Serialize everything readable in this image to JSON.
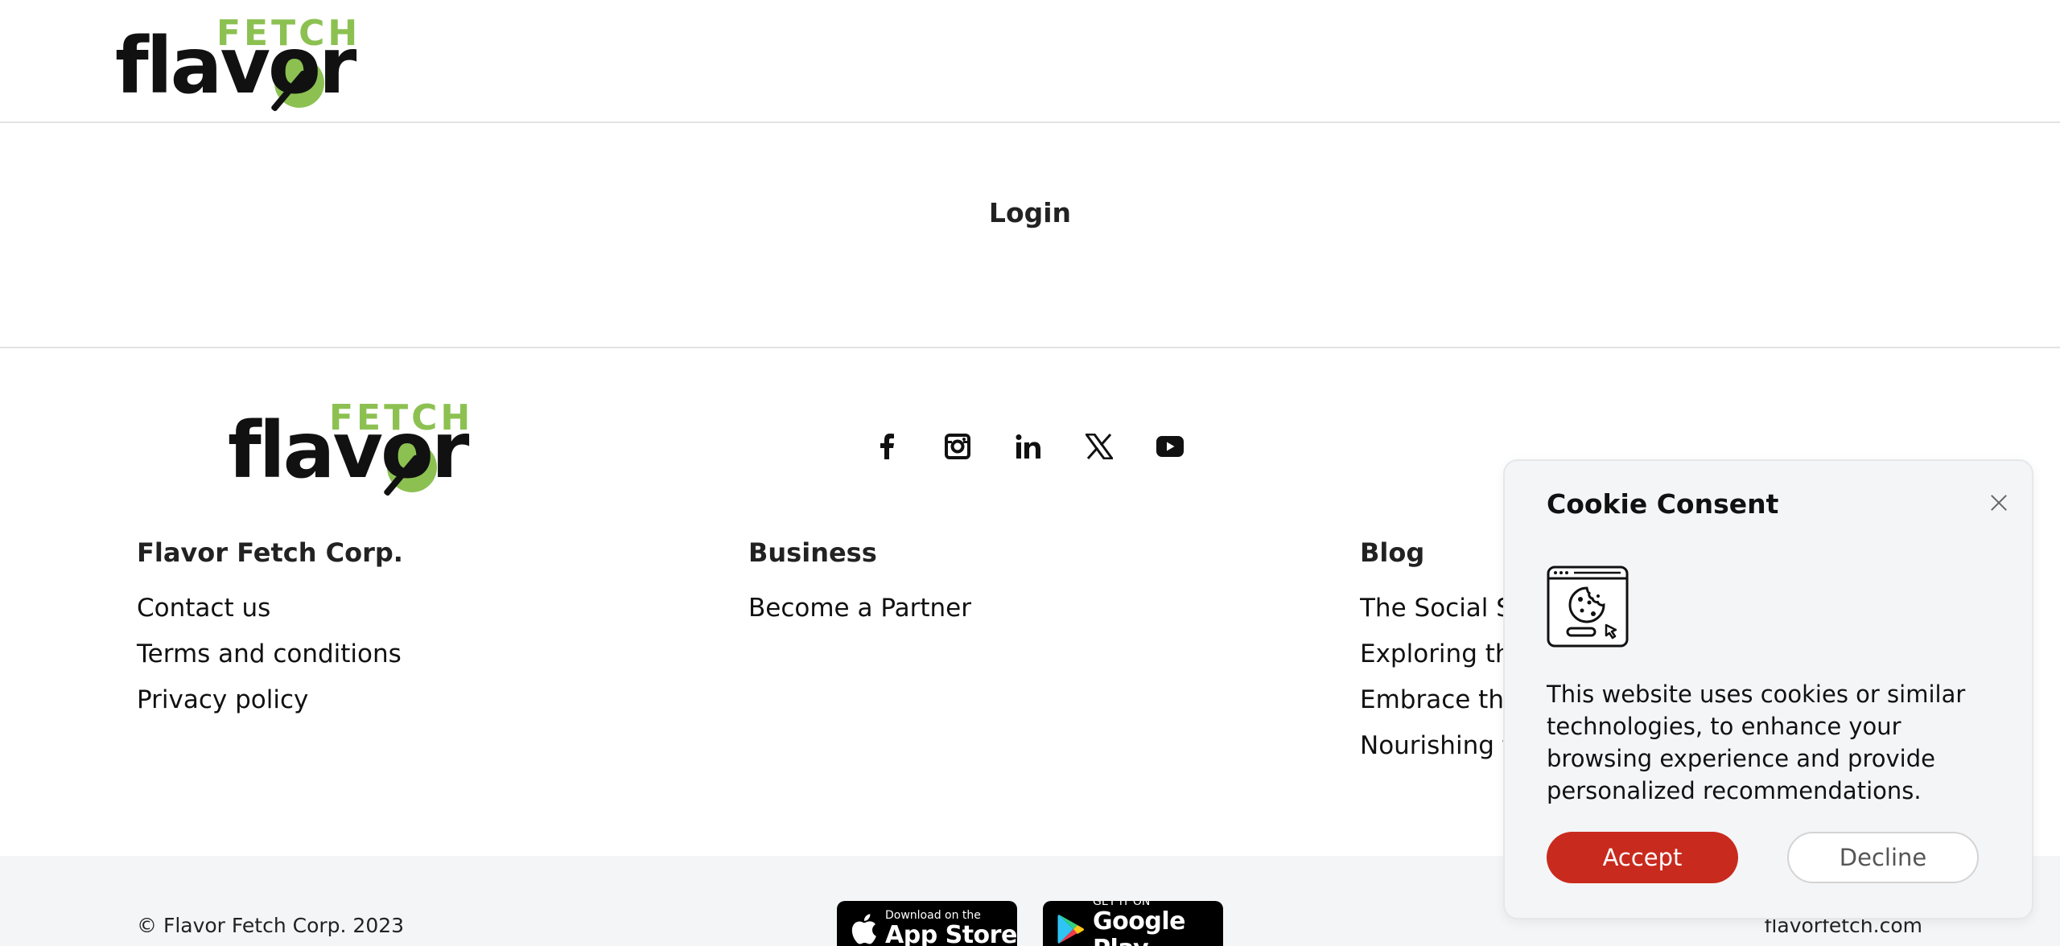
{
  "header": {
    "logo": {
      "top_word": "FETCH",
      "main_word": "flavor",
      "icon": "fork-plate-logo-icon"
    }
  },
  "login": {
    "label": "Login"
  },
  "footer": {
    "logo": {
      "top_word": "FETCH",
      "main_word": "flavor",
      "icon": "fork-plate-logo-icon"
    },
    "social": [
      "facebook-icon",
      "instagram-icon",
      "linkedin-icon",
      "x-twitter-icon",
      "youtube-icon"
    ],
    "columns": [
      {
        "heading": "Flavor Fetch Corp.",
        "links": [
          "Contact us",
          "Terms and conditions",
          "Privacy policy"
        ]
      },
      {
        "heading": "Business",
        "links": [
          "Become a Partner"
        ]
      },
      {
        "heading": "Blog",
        "links": [
          "The Social Sic",
          "Exploring the",
          "Embrace the",
          "Nourishing th"
        ]
      }
    ],
    "bottom": {
      "copyright": "© Flavor Fetch Corp. 2023",
      "domain": "flavorfetch.com",
      "app_store": {
        "small": "Download on the",
        "big": "App Store",
        "icon": "apple-icon"
      },
      "google_play": {
        "small": "GET IT ON",
        "big": "Google Play",
        "icon": "google-play-icon"
      }
    }
  },
  "cookie_consent": {
    "title": "Cookie Consent",
    "icon": "cookie-browser-icon",
    "text": "This website uses cookies or similar technologies, to enhance your browsing experience and provide personalized recommendations.",
    "accept_label": "Accept",
    "decline_label": "Decline",
    "colors": {
      "accept_bg": "#c92a1e",
      "panel_bg": "#f4f5f7"
    }
  },
  "colors": {
    "brand_green": "#8cc152",
    "text": "#111111",
    "bottom_bar": "#f4f5f7"
  }
}
